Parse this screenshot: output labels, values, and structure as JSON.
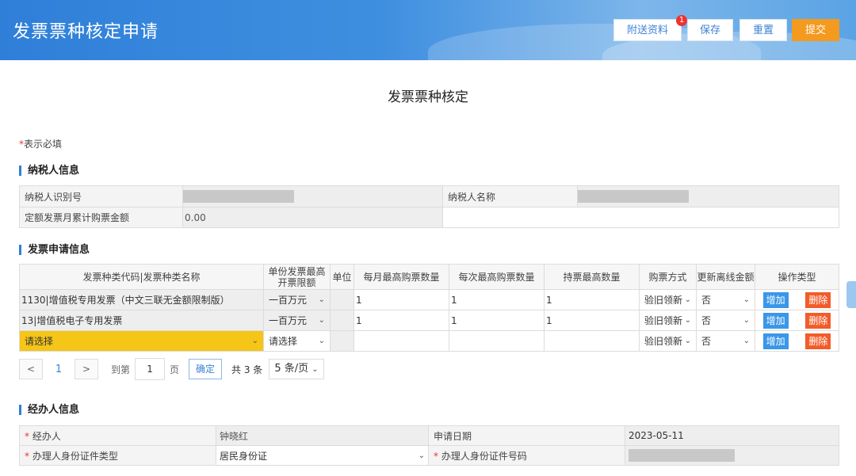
{
  "header": {
    "title": "发票票种核定申请",
    "buttons": {
      "attach": "附送资料",
      "attach_badge": "1",
      "save": "保存",
      "reset": "重置",
      "submit": "提交"
    }
  },
  "main": {
    "heading": "发票票种核定",
    "required_note_star": "*",
    "required_note": "表示必填"
  },
  "taxpayer": {
    "section_title": "纳税人信息",
    "id_label": "纳税人识别号",
    "name_label": "纳税人名称",
    "monthly_total_label": "定额发票月累计购票金额",
    "monthly_total_value": "0.00"
  },
  "apply": {
    "section_title": "发票申请信息",
    "headers": [
      "发票种类代码|发票种类名称",
      "单份发票最高开票限额",
      "单位",
      "每月最高购票数量",
      "每次最高购票数量",
      "持票最高数量",
      "购票方式",
      "更新离线金额",
      "操作类型"
    ],
    "rows": [
      {
        "type": "1130|增值税专用发票（中文三联无金额限制版）",
        "limit": "一百万元",
        "monthly": "1",
        "each": "1",
        "hold": "1",
        "method": "验旧领新",
        "update": "否",
        "add": "增加",
        "del": "删除"
      },
      {
        "type": "13|增值税电子专用发票",
        "limit": "一百万元",
        "monthly": "1",
        "each": "1",
        "hold": "1",
        "method": "验旧领新",
        "update": "否",
        "add": "增加",
        "del": "删除"
      },
      {
        "type": "请选择",
        "limit": "请选择",
        "monthly": "",
        "each": "",
        "hold": "",
        "method": "验旧领新",
        "update": "否",
        "add": "增加",
        "del": "删除"
      }
    ]
  },
  "pager": {
    "prev": "<",
    "current": "1",
    "next": ">",
    "goto_label": "到第",
    "goto_value": "1",
    "page_unit": "页",
    "confirm": "确定",
    "total": "共 3 条",
    "page_size": "5 条/页"
  },
  "handler": {
    "section_title": "经办人信息",
    "agent_label": "经办人",
    "agent_value": "钟晓红",
    "date_label": "申请日期",
    "date_value": "2023-05-11",
    "id_type_label": "办理人身份证件类型",
    "id_type_value": "居民身份证",
    "id_no_label": "办理人身份证件号码",
    "star": "*"
  },
  "colors": {
    "accent": "#2f7fd9",
    "submit": "#f39a1f",
    "add": "#3a97e8",
    "delete": "#f25c2a",
    "highlight": "#f5c518"
  }
}
